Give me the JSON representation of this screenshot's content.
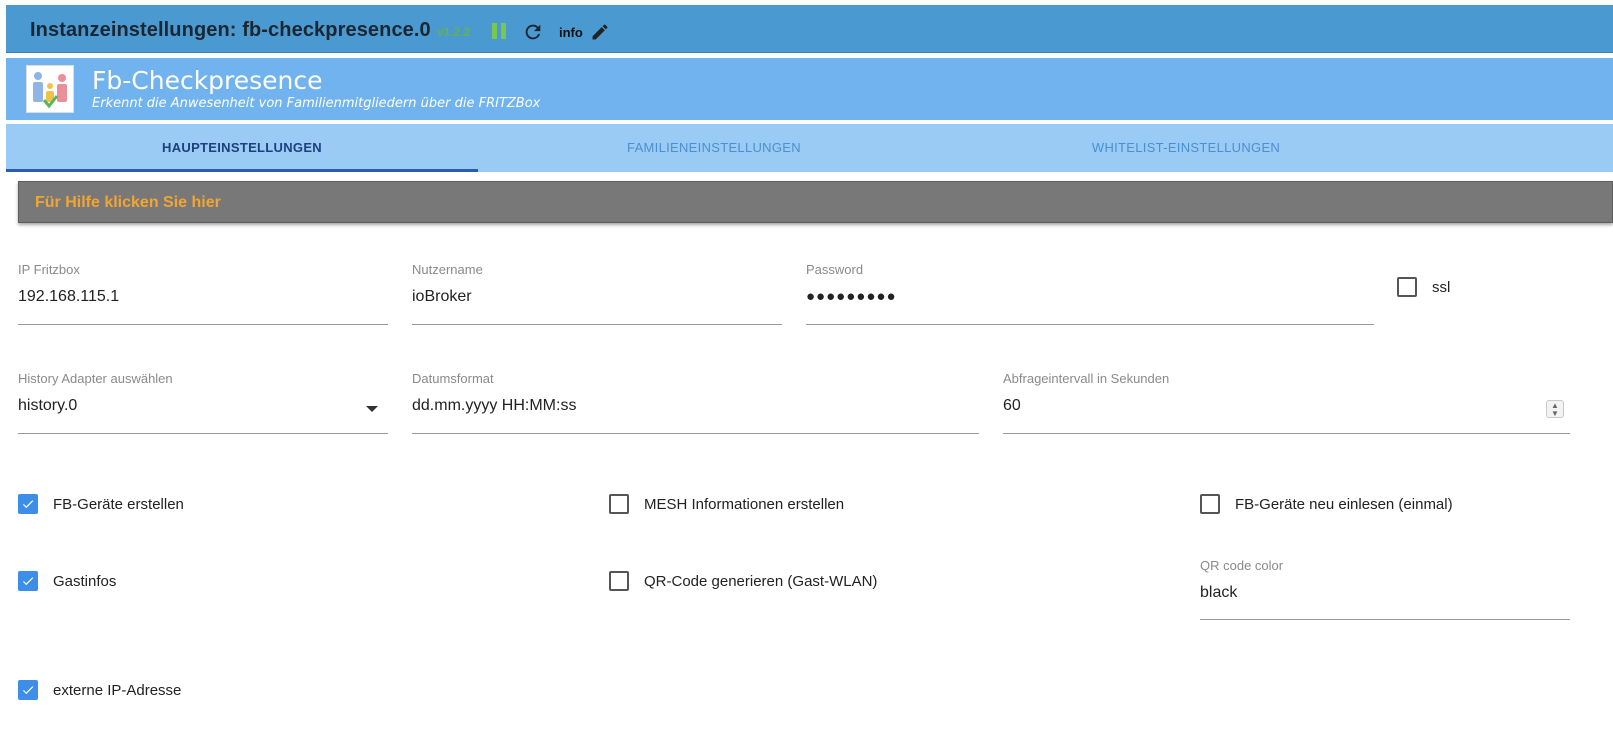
{
  "header": {
    "title": "Instanzeinstellungen: fb-checkpresence.0",
    "version": "v1.2.2",
    "info_label": "info"
  },
  "adapter": {
    "name": "Fb-Checkpresence",
    "description": "Erkennt die Anwesenheit von Familienmitgliedern über die FRITZBox"
  },
  "tabs": [
    {
      "label": "HAUPTEINSTELLUNGEN",
      "active": true
    },
    {
      "label": "FAMILIENEINSTELLUNGEN",
      "active": false
    },
    {
      "label": "WHITELIST-EINSTELLUNGEN",
      "active": false
    }
  ],
  "help": {
    "label": "Für Hilfe klicken Sie hier"
  },
  "fields": {
    "ip": {
      "label": "IP Fritzbox",
      "value": "192.168.115.1"
    },
    "user": {
      "label": "Nutzername",
      "value": "ioBroker"
    },
    "password": {
      "label": "Password",
      "value": "●●●●●●●●●"
    },
    "history": {
      "label": "History Adapter auswählen",
      "value": "history.0"
    },
    "dateformat": {
      "label": "Datumsformat",
      "value": "dd.mm.yyyy HH:MM:ss"
    },
    "interval": {
      "label": "Abfrageintervall in Sekunden",
      "value": "60"
    },
    "qrcolor": {
      "label": "QR code color",
      "value": "black"
    }
  },
  "checkboxes": {
    "ssl": {
      "label": "ssl",
      "checked": false
    },
    "fb_devices": {
      "label": "FB-Geräte erstellen",
      "checked": true
    },
    "mesh": {
      "label": "MESH Informationen erstellen",
      "checked": false
    },
    "fb_reload": {
      "label": "FB-Geräte neu einlesen (einmal)",
      "checked": false
    },
    "guest": {
      "label": "Gastinfos",
      "checked": true
    },
    "qr": {
      "label": "QR-Code generieren (Gast-WLAN)",
      "checked": false
    },
    "ext_ip": {
      "label": "externe IP-Adresse",
      "checked": true
    }
  },
  "colors": {
    "title_bar": "#4a9ad1",
    "adapter_bar": "#71b3ef",
    "tab_bar": "#99cbf5",
    "checkbox_checked": "#3d8ee8",
    "help_text": "#f2a533"
  }
}
